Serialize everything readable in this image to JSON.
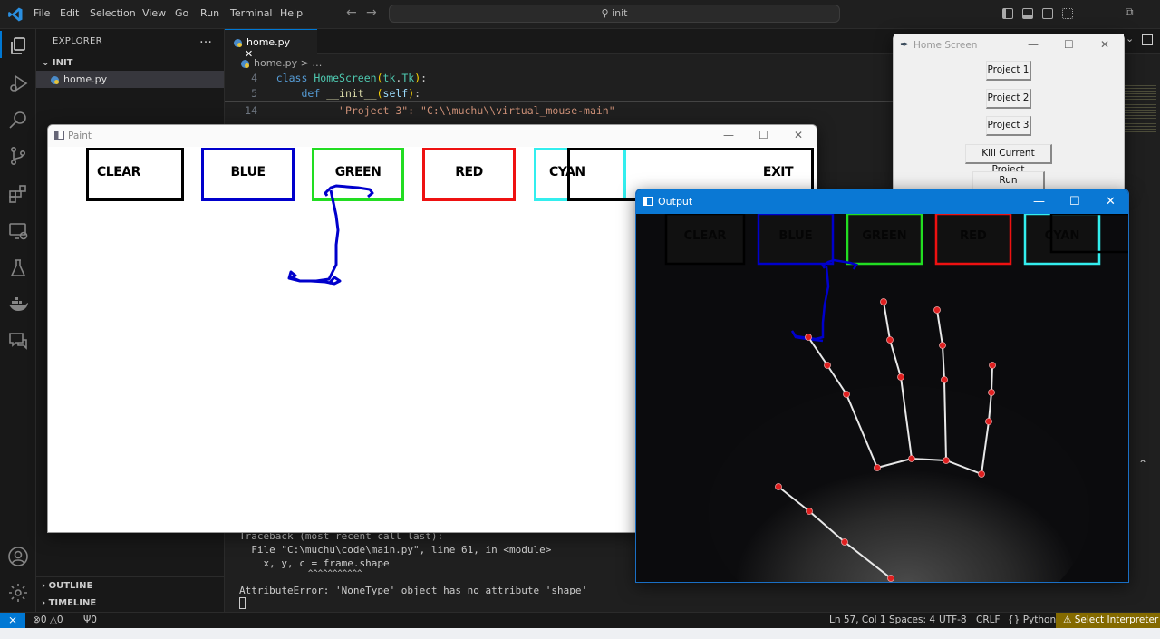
{
  "titlebar": {
    "menu": [
      "File",
      "Edit",
      "Selection",
      "View",
      "Go",
      "Run",
      "Terminal",
      "Help"
    ],
    "search_text": "init"
  },
  "activitybar": {
    "icons": [
      "explorer-icon",
      "run-debug-icon",
      "search-icon",
      "source-control-icon",
      "extensions-icon",
      "remote-explorer-icon",
      "testing-icon",
      "docker-icon",
      "chat-icon"
    ],
    "bottom_icons": [
      "account-icon",
      "settings-gear-icon"
    ]
  },
  "sidebar": {
    "title": "EXPLORER",
    "more": "…",
    "folder": "INIT",
    "files": [
      "home.py"
    ],
    "outline": "OUTLINE",
    "timeline": "TIMELINE"
  },
  "editor": {
    "tab_label": "home.py",
    "breadcrumb": "home.py > …",
    "lines": [
      {
        "num": "4",
        "text": "class HomeScreen(tk.Tk):"
      },
      {
        "num": "5",
        "text": "def __init__(self):"
      },
      {
        "num": "14",
        "text": "\"Project 3\": \"C:\\\\muchu\\\\virtual_mouse-main\""
      }
    ]
  },
  "terminal": {
    "lines": [
      "Traceback (most recent call last):",
      "  File \"C:\\muchu\\code\\main.py\", line 61, in <module>",
      "    x, y, c = frame.shape",
      "              ^^^^^^^^^^^",
      "AttributeError: 'NoneType' object has no attribute 'shape'"
    ]
  },
  "statusbar": {
    "errors": "0",
    "warnings": "0",
    "ports": "0",
    "position": "Ln 57, Col 1",
    "spaces": "Spaces: 4",
    "encoding": "UTF-8",
    "eol": "CRLF",
    "language": "Python",
    "interpreter": "Select Interpreter"
  },
  "paint_window": {
    "title": "Paint",
    "buttons": [
      {
        "label": "CLEAR",
        "color": "#000000"
      },
      {
        "label": "BLUE",
        "color": "#0000cc"
      },
      {
        "label": "GREEN",
        "color": "#22dd22"
      },
      {
        "label": "RED",
        "color": "#ee1111"
      },
      {
        "label": "CYAN",
        "color": "#33eeee"
      },
      {
        "label": "EXIT",
        "color": "#000000"
      }
    ],
    "stroke_color": "#0000cc"
  },
  "home_window": {
    "title": "Home Screen",
    "buttons": [
      "Project 1",
      "Project 2",
      "Project 3",
      "Kill Current Project",
      "Run PowerPoint"
    ]
  },
  "output_window": {
    "title": "Output",
    "buttons": [
      {
        "label": "CLEAR",
        "color": "#000000"
      },
      {
        "label": "BLUE",
        "color": "#0000cc"
      },
      {
        "label": "GREEN",
        "color": "#22dd22"
      },
      {
        "label": "RED",
        "color": "#ee1111"
      },
      {
        "label": "CYAN",
        "color": "#33eeee"
      }
    ],
    "landmark_color": "#e02020",
    "skeleton_color": "#e8e8e8"
  }
}
